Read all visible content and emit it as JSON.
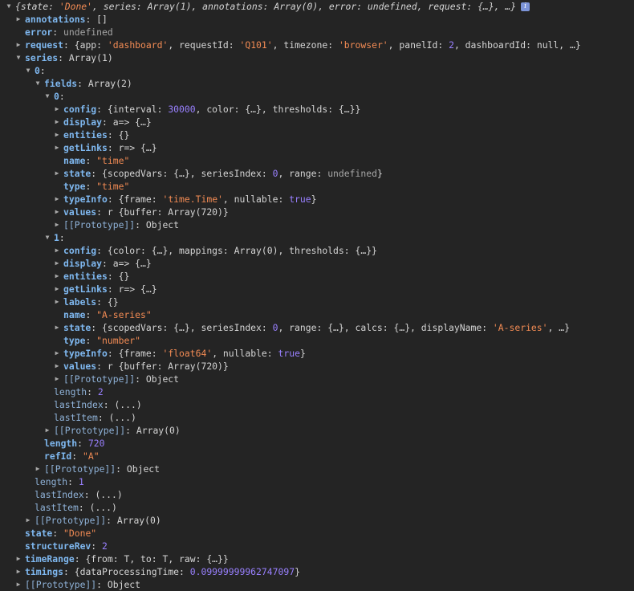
{
  "rows": [
    {
      "i": 0,
      "t": "down",
      "cls": "it",
      "tokens": [
        [
          "p",
          "{"
        ],
        [
          "p",
          "state: "
        ],
        [
          "s",
          "'Done'"
        ],
        [
          "p",
          ", series: Array(1), annotations: Array(0), error: undefined, request: {…}, …}"
        ]
      ],
      "info": true
    },
    {
      "i": 1,
      "t": "right",
      "key": "annotations",
      "tokens": [
        [
          "p",
          "[]"
        ]
      ]
    },
    {
      "i": 1,
      "t": "none",
      "key": "error",
      "tokens": [
        [
          "u",
          "undefined"
        ]
      ]
    },
    {
      "i": 1,
      "t": "right",
      "key": "request",
      "tokens": [
        [
          "p",
          "{app: "
        ],
        [
          "s",
          "'dashboard'"
        ],
        [
          "p",
          ", requestId: "
        ],
        [
          "s",
          "'Q101'"
        ],
        [
          "p",
          ", timezone: "
        ],
        [
          "s",
          "'browser'"
        ],
        [
          "p",
          ", panelId: "
        ],
        [
          "n",
          "2"
        ],
        [
          "p",
          ", dashboardId: null, …}"
        ]
      ]
    },
    {
      "i": 1,
      "t": "down",
      "key": "series",
      "tokens": [
        [
          "p",
          "Array(1)"
        ]
      ]
    },
    {
      "i": 2,
      "t": "down",
      "key": "0",
      "tokens": []
    },
    {
      "i": 3,
      "t": "down",
      "key": "fields",
      "tokens": [
        [
          "p",
          "Array(2)"
        ]
      ]
    },
    {
      "i": 4,
      "t": "down",
      "key": "0",
      "tokens": []
    },
    {
      "i": 5,
      "t": "right",
      "key": "config",
      "tokens": [
        [
          "p",
          "{interval: "
        ],
        [
          "n",
          "30000"
        ],
        [
          "p",
          ", color: {…}, thresholds: {…}}"
        ]
      ]
    },
    {
      "i": 5,
      "t": "right",
      "key": "display",
      "tokens": [
        [
          "p",
          "a=> {…}"
        ]
      ]
    },
    {
      "i": 5,
      "t": "right",
      "key": "entities",
      "tokens": [
        [
          "p",
          "{}"
        ]
      ]
    },
    {
      "i": 5,
      "t": "right",
      "key": "getLinks",
      "tokens": [
        [
          "p",
          "r=> {…}"
        ]
      ]
    },
    {
      "i": 5,
      "t": "none",
      "key": "name",
      "tokens": [
        [
          "s",
          "\"time\""
        ]
      ]
    },
    {
      "i": 5,
      "t": "right",
      "key": "state",
      "tokens": [
        [
          "p",
          "{scopedVars: {…}, seriesIndex: "
        ],
        [
          "n",
          "0"
        ],
        [
          "p",
          ", range: "
        ],
        [
          "u",
          "undefined"
        ],
        [
          "p",
          "}"
        ]
      ]
    },
    {
      "i": 5,
      "t": "none",
      "key": "type",
      "tokens": [
        [
          "s",
          "\"time\""
        ]
      ]
    },
    {
      "i": 5,
      "t": "right",
      "key": "typeInfo",
      "tokens": [
        [
          "p",
          "{frame: "
        ],
        [
          "s",
          "'time.Time'"
        ],
        [
          "p",
          ", nullable: "
        ],
        [
          "b",
          "true"
        ],
        [
          "p",
          "}"
        ]
      ]
    },
    {
      "i": 5,
      "t": "right",
      "key": "values",
      "tokens": [
        [
          "p",
          "r {buffer: Array(720)}"
        ]
      ]
    },
    {
      "i": 5,
      "t": "right",
      "key": "[[Prototype]]",
      "kcls": "kp",
      "tokens": [
        [
          "p",
          "Object"
        ]
      ]
    },
    {
      "i": 4,
      "t": "down",
      "key": "1",
      "tokens": []
    },
    {
      "i": 5,
      "t": "right",
      "key": "config",
      "tokens": [
        [
          "p",
          "{color: {…}, mappings: Array(0), thresholds: {…}}"
        ]
      ]
    },
    {
      "i": 5,
      "t": "right",
      "key": "display",
      "tokens": [
        [
          "p",
          "a=> {…}"
        ]
      ]
    },
    {
      "i": 5,
      "t": "right",
      "key": "entities",
      "tokens": [
        [
          "p",
          "{}"
        ]
      ]
    },
    {
      "i": 5,
      "t": "right",
      "key": "getLinks",
      "tokens": [
        [
          "p",
          "r=> {…}"
        ]
      ]
    },
    {
      "i": 5,
      "t": "right",
      "key": "labels",
      "tokens": [
        [
          "p",
          "{}"
        ]
      ]
    },
    {
      "i": 5,
      "t": "none",
      "key": "name",
      "tokens": [
        [
          "s",
          "\"A-series\""
        ]
      ]
    },
    {
      "i": 5,
      "t": "right",
      "key": "state",
      "tokens": [
        [
          "p",
          "{scopedVars: {…}, seriesIndex: "
        ],
        [
          "n",
          "0"
        ],
        [
          "p",
          ", range: {…}, calcs: {…}, displayName: "
        ],
        [
          "s",
          "'A-series'"
        ],
        [
          "p",
          ", …}"
        ]
      ]
    },
    {
      "i": 5,
      "t": "none",
      "key": "type",
      "tokens": [
        [
          "s",
          "\"number\""
        ]
      ]
    },
    {
      "i": 5,
      "t": "right",
      "key": "typeInfo",
      "tokens": [
        [
          "p",
          "{frame: "
        ],
        [
          "s",
          "'float64'"
        ],
        [
          "p",
          ", nullable: "
        ],
        [
          "b",
          "true"
        ],
        [
          "p",
          "}"
        ]
      ]
    },
    {
      "i": 5,
      "t": "right",
      "key": "values",
      "tokens": [
        [
          "p",
          "r {buffer: Array(720)}"
        ]
      ]
    },
    {
      "i": 5,
      "t": "right",
      "key": "[[Prototype]]",
      "kcls": "kp",
      "tokens": [
        [
          "p",
          "Object"
        ]
      ]
    },
    {
      "i": 4,
      "t": "none",
      "key": "length",
      "kcls": "kp",
      "tokens": [
        [
          "n",
          "2"
        ]
      ]
    },
    {
      "i": 4,
      "t": "none",
      "key": "lastIndex",
      "kcls": "kp",
      "tokens": [
        [
          "p",
          "(...)"
        ]
      ]
    },
    {
      "i": 4,
      "t": "none",
      "key": "lastItem",
      "kcls": "kp",
      "tokens": [
        [
          "p",
          "(...)"
        ]
      ]
    },
    {
      "i": 4,
      "t": "right",
      "key": "[[Prototype]]",
      "kcls": "kp",
      "tokens": [
        [
          "p",
          "Array(0)"
        ]
      ]
    },
    {
      "i": 3,
      "t": "none",
      "key": "length",
      "tokens": [
        [
          "n",
          "720"
        ]
      ]
    },
    {
      "i": 3,
      "t": "none",
      "key": "refId",
      "tokens": [
        [
          "s",
          "\"A\""
        ]
      ]
    },
    {
      "i": 3,
      "t": "right",
      "key": "[[Prototype]]",
      "kcls": "kp",
      "tokens": [
        [
          "p",
          "Object"
        ]
      ]
    },
    {
      "i": 2,
      "t": "none",
      "key": "length",
      "kcls": "kp",
      "tokens": [
        [
          "n",
          "1"
        ]
      ]
    },
    {
      "i": 2,
      "t": "none",
      "key": "lastIndex",
      "kcls": "kp",
      "tokens": [
        [
          "p",
          "(...)"
        ]
      ]
    },
    {
      "i": 2,
      "t": "none",
      "key": "lastItem",
      "kcls": "kp",
      "tokens": [
        [
          "p",
          "(...)"
        ]
      ]
    },
    {
      "i": 2,
      "t": "right",
      "key": "[[Prototype]]",
      "kcls": "kp",
      "tokens": [
        [
          "p",
          "Array(0)"
        ]
      ]
    },
    {
      "i": 1,
      "t": "none",
      "key": "state",
      "tokens": [
        [
          "s",
          "\"Done\""
        ]
      ]
    },
    {
      "i": 1,
      "t": "none",
      "key": "structureRev",
      "tokens": [
        [
          "n",
          "2"
        ]
      ]
    },
    {
      "i": 1,
      "t": "right",
      "key": "timeRange",
      "tokens": [
        [
          "p",
          "{from: T, to: T, raw: {…}}"
        ]
      ]
    },
    {
      "i": 1,
      "t": "right",
      "key": "timings",
      "tokens": [
        [
          "p",
          "{dataProcessingTime: "
        ],
        [
          "n",
          "0.09999999962747097"
        ],
        [
          "p",
          "}"
        ]
      ]
    },
    {
      "i": 1,
      "t": "right",
      "key": "[[Prototype]]",
      "kcls": "kp",
      "tokens": [
        [
          "p",
          "Object"
        ]
      ]
    }
  ]
}
